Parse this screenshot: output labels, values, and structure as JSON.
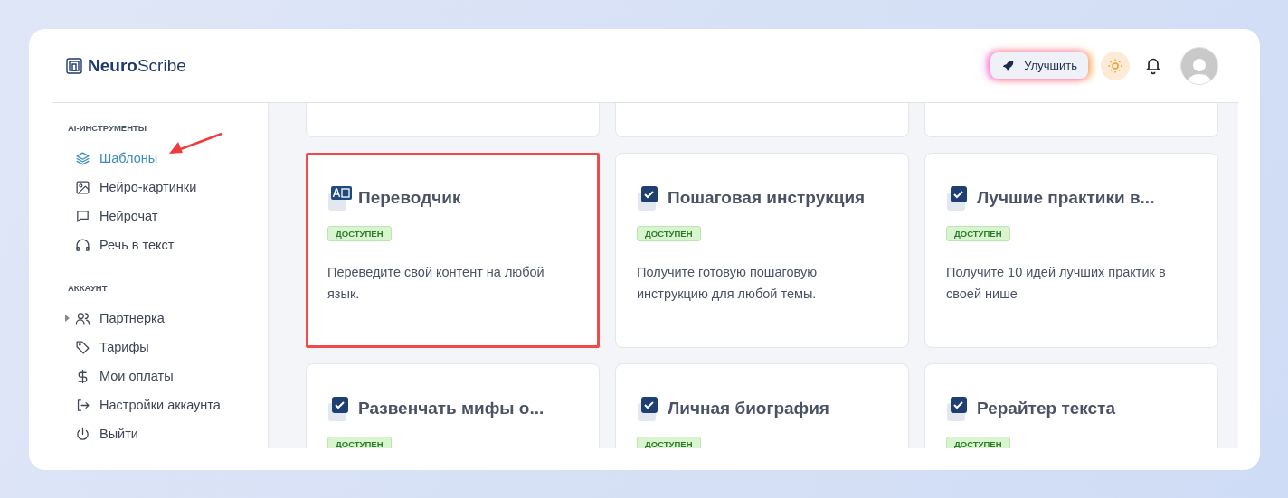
{
  "header": {
    "logo_bold": "Neuro",
    "logo_rest": "Scribe",
    "upgrade_button": "Улучшить"
  },
  "sidebar": {
    "sections": [
      {
        "title": "AI-ИНСТРУМЕНТЫ",
        "items": [
          {
            "label": "Шаблоны",
            "selected": true
          },
          {
            "label": "Нейро-картинки",
            "selected": false
          },
          {
            "label": "Нейрочат",
            "selected": false
          },
          {
            "label": "Речь в текст",
            "selected": false
          }
        ]
      },
      {
        "title": "АККАУНТ",
        "items": [
          {
            "label": "Партнерка",
            "selected": false,
            "expanded": false
          },
          {
            "label": "Тарифы",
            "selected": false
          },
          {
            "label": "Мои оплаты",
            "selected": false
          },
          {
            "label": "Настройки аккаунта",
            "selected": false
          },
          {
            "label": "Выйти",
            "selected": false
          }
        ]
      }
    ]
  },
  "annotation": {
    "arrow_to_item": true
  },
  "cards": [
    {
      "kind": "translate",
      "title": "Переводчик",
      "badge": "ДОСТУПЕН",
      "description": "Переведите свой контент на любой язык.",
      "highlighted": true
    },
    {
      "kind": "check",
      "title": "Пошаговая инструкция",
      "badge": "ДОСТУПЕН",
      "description": "Получите готовую пошаговую инструкцию для любой темы.",
      "highlighted": false
    },
    {
      "kind": "check",
      "title": "Лучшие практики в...",
      "badge": "ДОСТУПЕН",
      "description": "Получите 10 идей лучших практик в своей нише",
      "highlighted": false
    },
    {
      "kind": "check",
      "title": "Развенчать мифы о...",
      "badge": "ДОСТУПЕН",
      "highlighted": false
    },
    {
      "kind": "check",
      "title": "Личная биография",
      "badge": "ДОСТУПЕН",
      "highlighted": false
    },
    {
      "kind": "check",
      "title": "Рерайтер текста",
      "badge": "ДОСТУПЕН",
      "highlighted": false
    }
  ]
}
